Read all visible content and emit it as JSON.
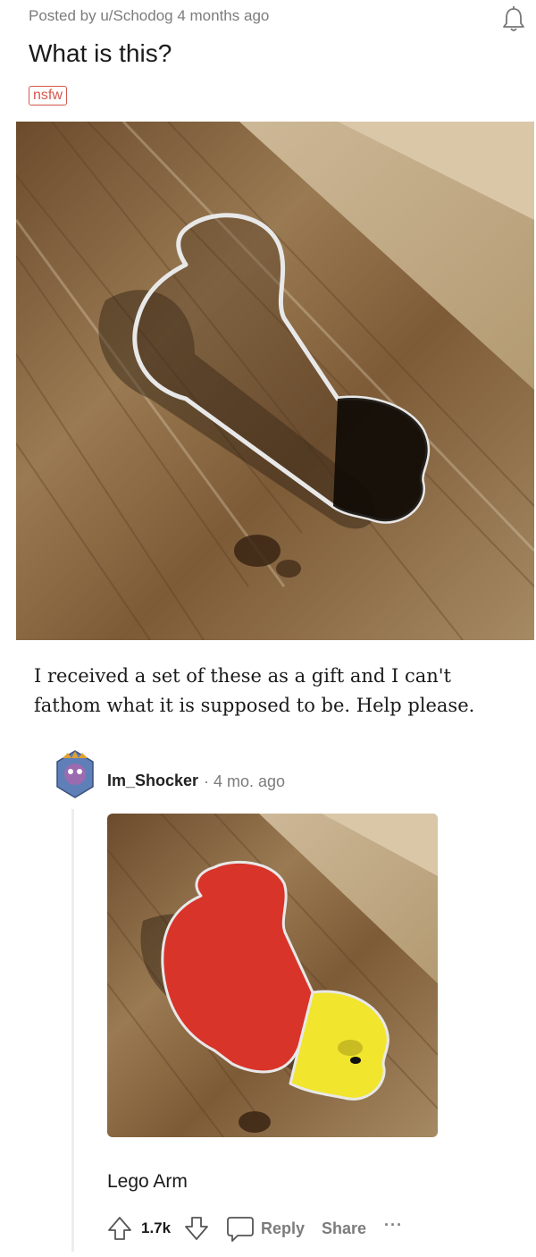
{
  "post": {
    "meta": "Posted by u/Schodog 4 months ago",
    "title": "What is this?",
    "flair": "nsfw",
    "body": "I received a set of these as a gift and I can't fathom what it is supposed to be. Help please."
  },
  "comment": {
    "username": "Im_Shocker",
    "time": "· 4 mo. ago",
    "text": "Lego Arm",
    "score": "1.7k",
    "reply_label": "Reply",
    "share_label": "Share",
    "more_label": "···"
  },
  "icons": {
    "bell": "bell-icon",
    "upvote": "upvote-arrow-icon",
    "downvote": "downvote-arrow-icon",
    "reply": "speech-bubble-icon"
  },
  "colors": {
    "flair": "#d4574e",
    "wood": "#8a6a45",
    "lego_red": "#d8342a",
    "lego_yellow": "#f1e52e"
  }
}
